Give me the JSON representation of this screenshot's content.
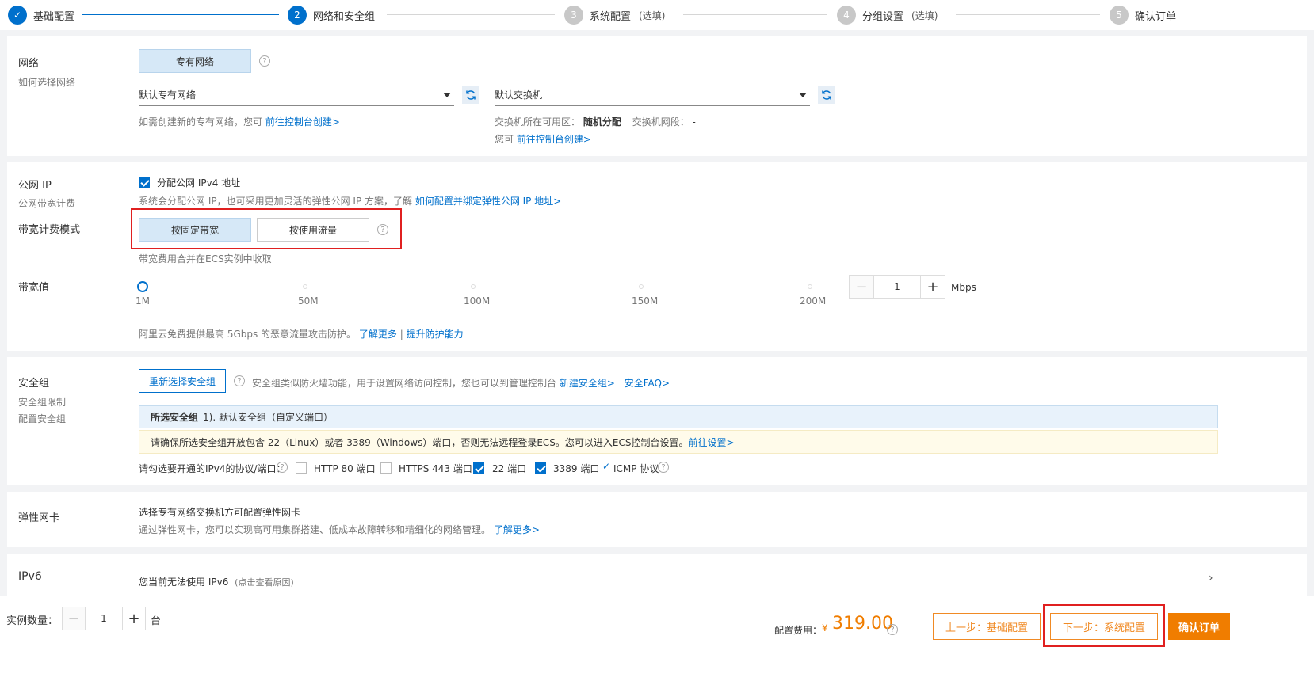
{
  "stepper": {
    "steps": [
      {
        "num": "✓",
        "label": "基础配置",
        "optional": ""
      },
      {
        "num": "2",
        "label": "网络和安全组",
        "optional": ""
      },
      {
        "num": "3",
        "label": "系统配置",
        "optional": "(选填)"
      },
      {
        "num": "4",
        "label": "分组设置",
        "optional": "(选填)"
      },
      {
        "num": "5",
        "label": "确认订单",
        "optional": ""
      }
    ]
  },
  "network": {
    "title": "网络",
    "subtitle": "如何选择网络",
    "type_button": "专有网络",
    "vpc_select": "默认专有网络",
    "vswitch_select": "默认交换机",
    "vpc_hint": "如需创建新的专有网络，您可",
    "vpc_hint_link": "前往控制台创建>",
    "zone_label": "交换机所在可用区：",
    "zone_value": "随机分配",
    "segment_label": "交换机网段：",
    "segment_value": "-",
    "vswitch_hint": "您可",
    "vswitch_hint_link": "前往控制台创建>"
  },
  "public_ip": {
    "title": "公网 IP",
    "subtitle": "公网带宽计费",
    "checkbox_label": "分配公网 IPv4 地址",
    "checked": true,
    "hint": "系统会分配公网 IP，也可采用更加灵活的弹性公网 IP 方案，了解",
    "hint_link": "如何配置并绑定弹性公网 IP 地址>",
    "billing_title": "带宽计费模式",
    "billing_options": [
      "按固定带宽",
      "按使用流量"
    ],
    "billing_selected": "按固定带宽",
    "billing_hint": "带宽费用合并在ECS实例中收取",
    "bandwidth_title": "带宽值",
    "slider_marks": [
      "1M",
      "50M",
      "100M",
      "150M",
      "200M"
    ],
    "bandwidth_value": "1",
    "bandwidth_unit": "Mbps",
    "ddos_text": "阿里云免费提供最高 5Gbps 的恶意流量攻击防护。",
    "ddos_link1": "了解更多",
    "ddos_sep": "|",
    "ddos_link2": "提升防护能力"
  },
  "security": {
    "title": "安全组",
    "subtitle1": "安全组限制",
    "subtitle2": "配置安全组",
    "reselect_button": "重新选择安全组",
    "desc": "安全组类似防火墙功能，用于设置网络访问控制，您也可以到管理控制台",
    "desc_link1": "新建安全组>",
    "desc_link2": "安全FAQ>",
    "selected_label": "所选安全组",
    "selected_value": "1). 默认安全组（自定义端口）",
    "warning": "请确保所选安全组开放包含 22（Linux）或者 3389（Windows）端口，否则无法远程登录ECS。您可以进入ECS控制台设置。",
    "warning_link": "前往设置>",
    "ports_label": "请勾选要开通的IPv4的协议/端口：",
    "ports": [
      {
        "label": "HTTP 80 端口",
        "checked": false
      },
      {
        "label": "HTTPS 443 端口",
        "checked": false
      },
      {
        "label": "22 端口",
        "checked": true
      },
      {
        "label": "3389 端口",
        "checked": true
      }
    ],
    "icmp_label": "ICMP 协议"
  },
  "eni": {
    "title": "弹性网卡",
    "line1": "选择专有网络交换机方可配置弹性网卡",
    "line2": "通过弹性网卡，您可以实现高可用集群搭建、低成本故障转移和精细化的网络管理。",
    "line2_link": "了解更多>"
  },
  "ipv6": {
    "title": "IPv6",
    "text": "您当前无法使用 IPv6",
    "note": "(点击查看原因)"
  },
  "footer": {
    "qty_label": "实例数量：",
    "qty_value": "1",
    "qty_unit": "台",
    "cost_label": "配置费用：",
    "currency": "¥",
    "price": "319.00",
    "prev_button": "上一步：基础配置",
    "next_button": "下一步：系统配置",
    "confirm_button": "确认订单"
  },
  "colors": {
    "accent": "#0070cc",
    "orange": "#f07d00",
    "highlight_red": "#e02020"
  }
}
